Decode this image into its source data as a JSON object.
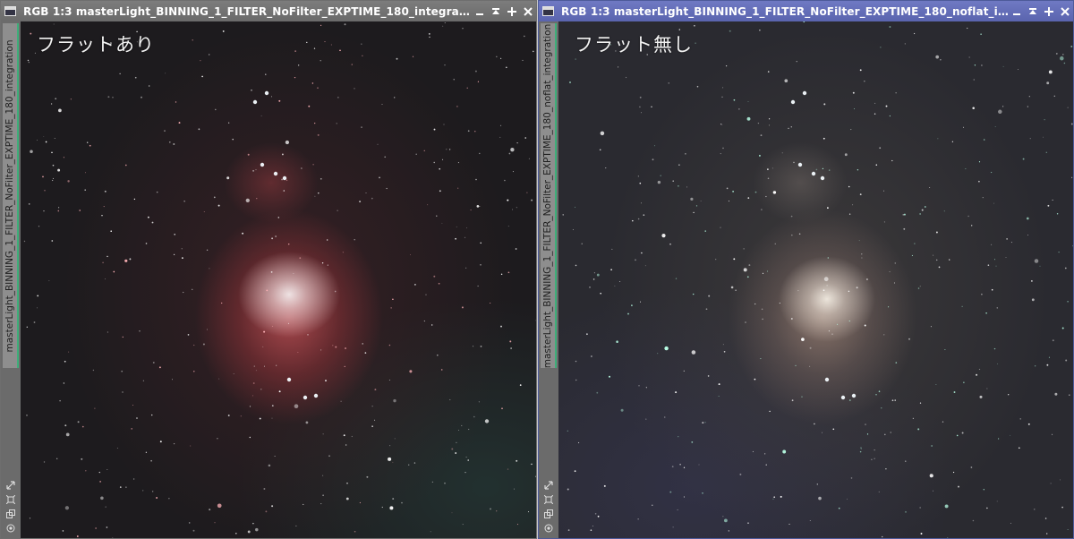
{
  "windows": [
    {
      "id": "left",
      "title": "RGB 1:3 masterLight_BINNING_1_FILTER_NoFilter_EXPTIME_180_integration |...",
      "side_tab_label": "masterLight_BINNING_1_FILTER_NoFilter_EXPTIME_180_integration",
      "caption": "フラットあり",
      "active": false
    },
    {
      "id": "right",
      "title": "RGB 1:3 masterLight_BINNING_1_FILTER_NoFilter_EXPTIME_180_noflat_integ...",
      "side_tab_label": "masterLight_BINNING_1_FILTER_NoFilter_EXPTIME_180_noflat_integration",
      "caption": "フラット無し",
      "active": true
    }
  ],
  "controls": [
    "minimize-icon",
    "shade-icon",
    "maximize-icon",
    "close-icon"
  ],
  "sidebar_icons": [
    "fit-view-icon",
    "zoom-icon",
    "clone-icon",
    "settings-icon"
  ],
  "colors": {
    "inactive_titlebar": "#6f6f6f",
    "active_titlebar": "#5f69b2",
    "tab_accent": "#3fae7a"
  }
}
